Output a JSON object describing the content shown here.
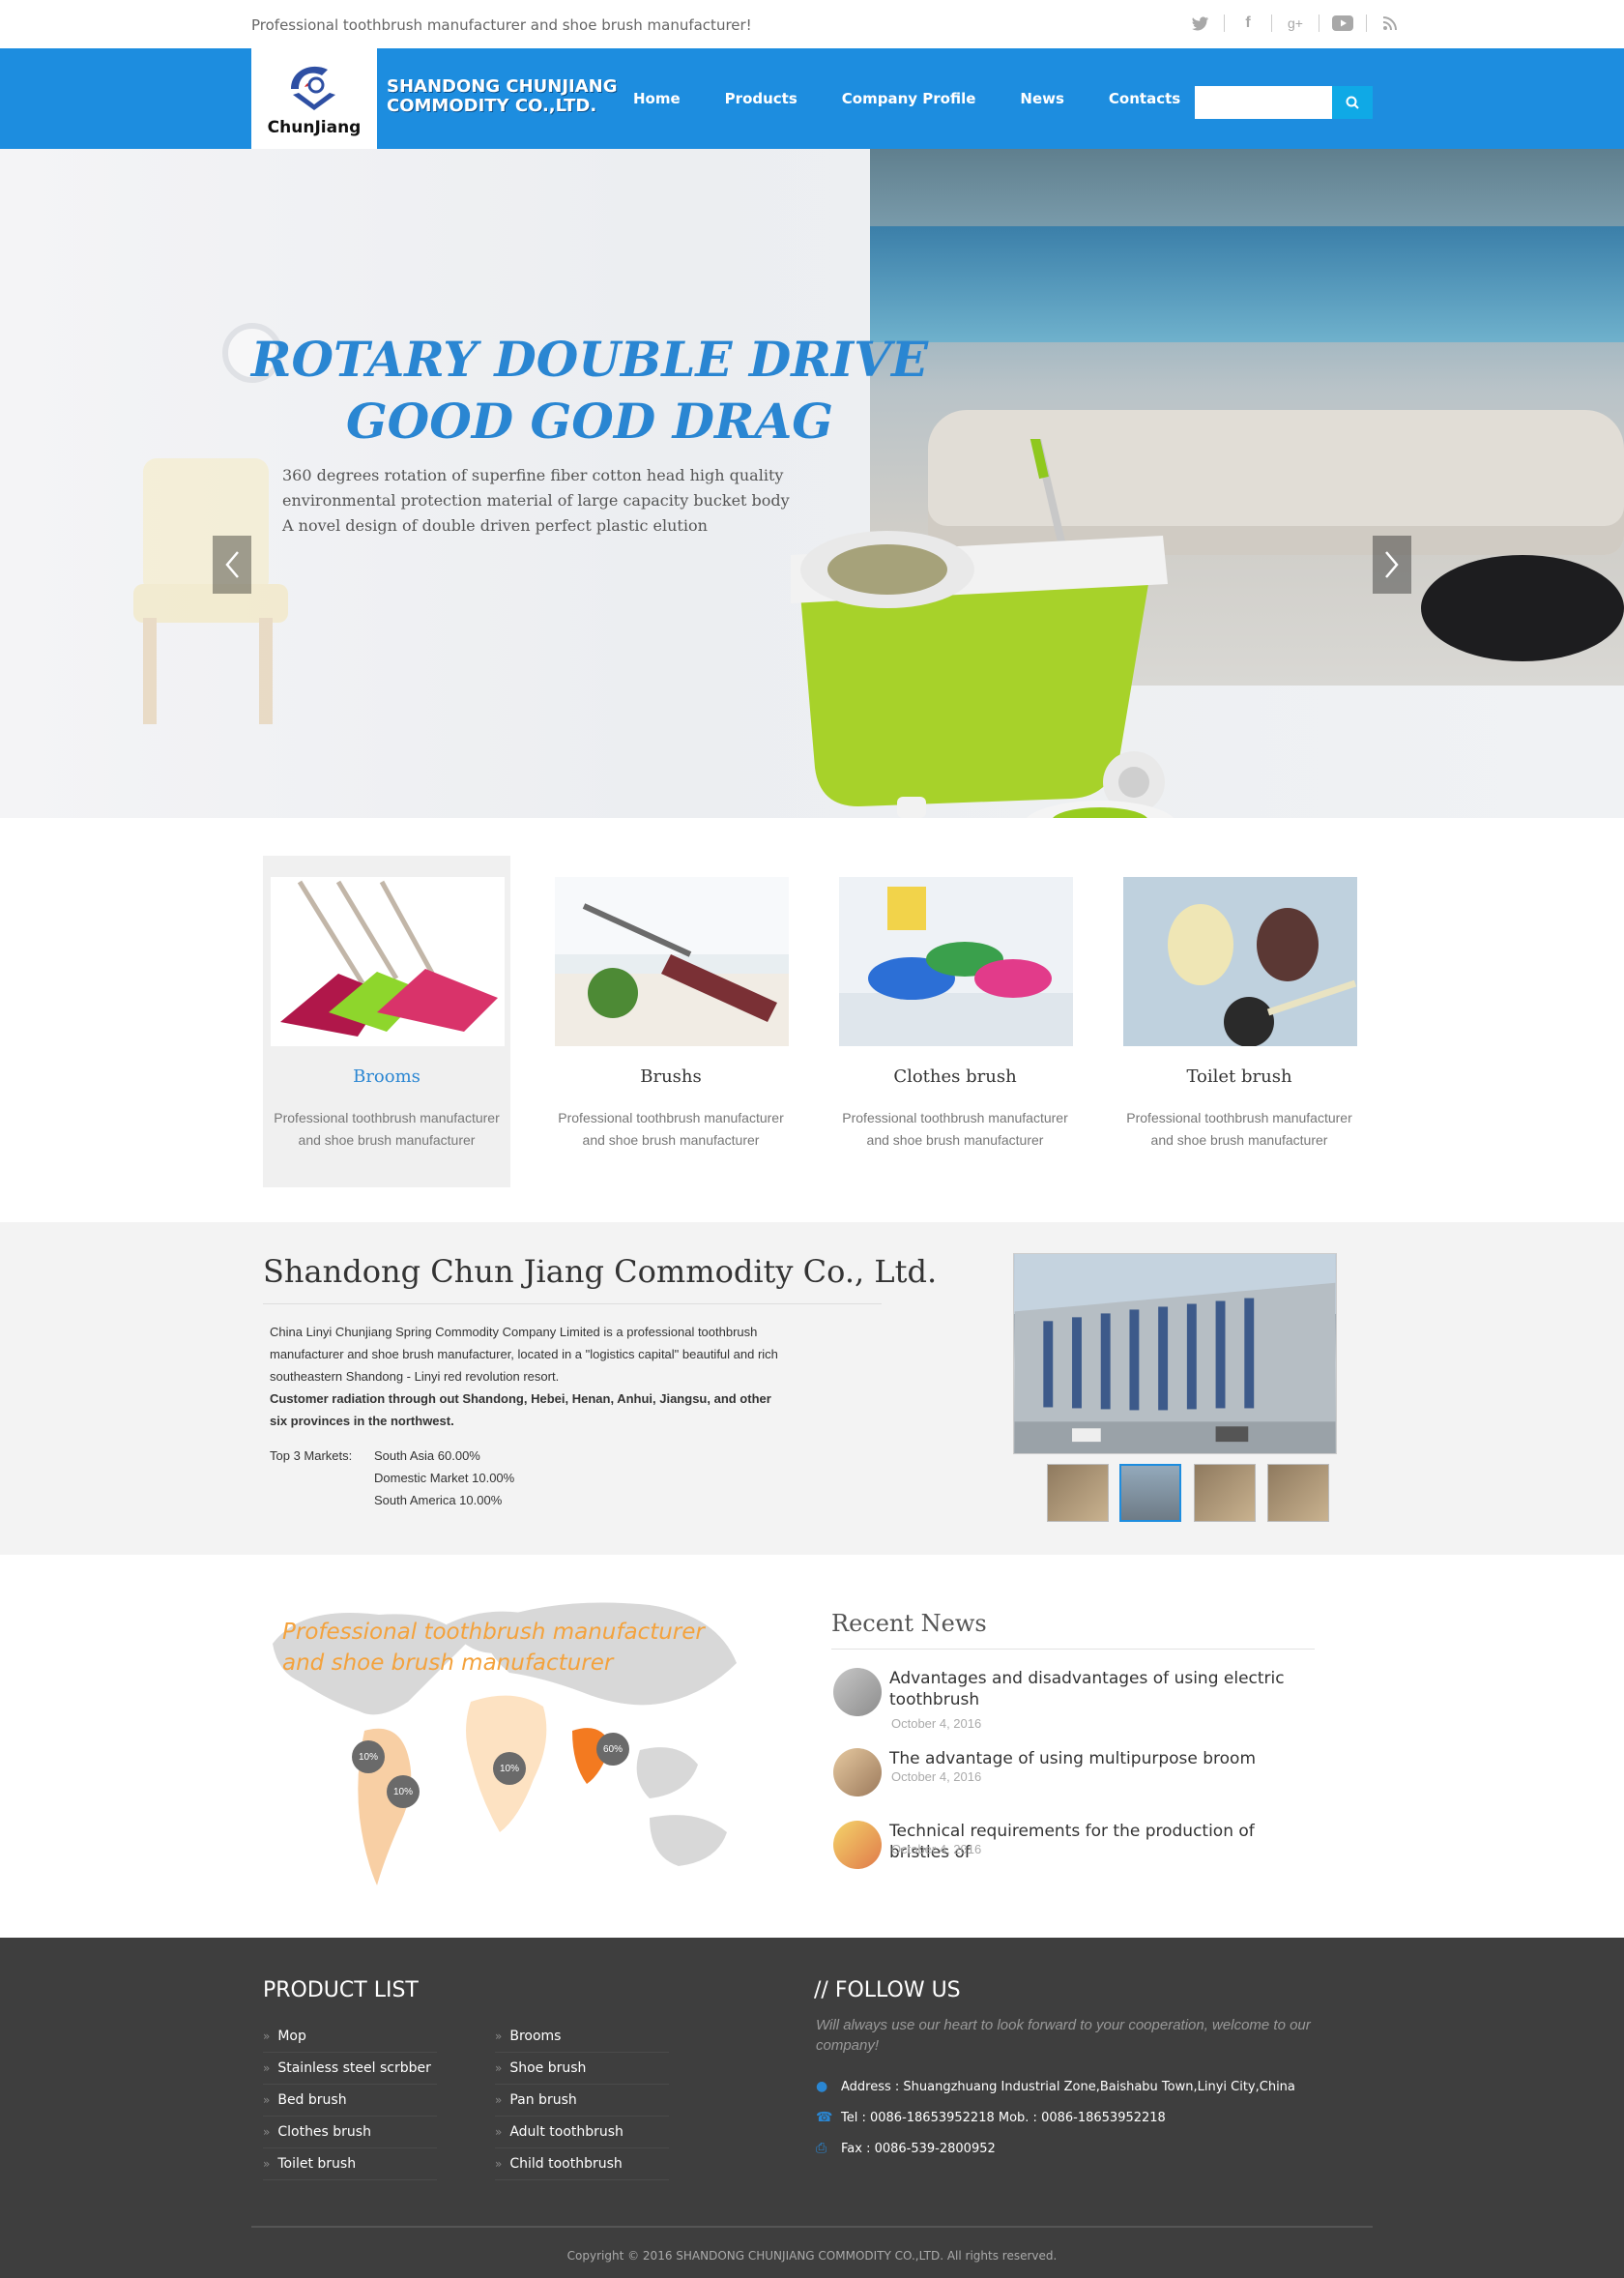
{
  "topbar": {
    "tagline": "Professional toothbrush manufacturer and shoe brush manufacturer!",
    "social_icons": [
      "twitter-icon",
      "facebook-icon",
      "google-plus-icon",
      "youtube-icon",
      "rss-icon"
    ]
  },
  "header": {
    "logo_text": "ChunJiang",
    "company_line1": "SHANDONG CHUNJIANG",
    "company_line2": "COMMODITY CO.,LTD.",
    "nav": [
      "Home",
      "Products",
      "Company Profile",
      "News",
      "Contacts"
    ],
    "search_placeholder": ""
  },
  "hero": {
    "title_line1": "ROTARY DOUBLE DRIVE",
    "title_line2": "GOOD GOD DRAG",
    "text_line1": "360 degrees rotation of superfine fiber cotton head high quality",
    "text_line2": "environmental protection material of large capacity bucket body",
    "text_line3": "A novel design of double driven perfect plastic elution",
    "slides": 3,
    "active_slide": 2
  },
  "categories": [
    {
      "title": "Brooms",
      "desc": "Professional toothbrush manufacturer and shoe brush manufacturer"
    },
    {
      "title": "Brushs",
      "desc": "Professional toothbrush manufacturer and shoe brush manufacturer"
    },
    {
      "title": "Clothes brush",
      "desc": "Professional toothbrush manufacturer and shoe brush manufacturer"
    },
    {
      "title": "Toilet brush",
      "desc": "Professional toothbrush manufacturer and shoe brush manufacturer"
    }
  ],
  "about": {
    "title": "Shandong Chun Jiang Commodity Co., Ltd.",
    "para1": "China Linyi Chunjiang Spring Commodity Company Limited is a professional toothbrush manufacturer and shoe brush manufacturer, located in a \"logistics capital\" beautiful and rich southeastern Shandong - Linyi red revolution resort.",
    "para2": "Customer radiation through out Shandong, Hebei, Henan, Anhui, Jiangsu, and other six provinces in the northwest.",
    "markets_label": "Top 3 Markets:",
    "markets": [
      "South Asia 60.00%",
      "Domestic Market 10.00%",
      "South America 10.00%"
    ]
  },
  "map": {
    "caption": "Professional toothbrush manufacturer and shoe brush manufacturer",
    "pins": [
      "10%",
      "10%",
      "10%",
      "60%"
    ]
  },
  "news": {
    "title": "Recent News",
    "items": [
      {
        "title": "Advantages and disadvantages of using electric toothbrush",
        "date": "October 4, 2016"
      },
      {
        "title": "The advantage of using multipurpose broom",
        "date": "October 4, 2016"
      },
      {
        "title": "Technical requirements for the production of bristles of",
        "date": "October 4, 2016"
      }
    ]
  },
  "footer": {
    "product_list_title": "PRODUCT LIST",
    "col1": [
      "Mop",
      "Stainless steel scrbber",
      "Bed brush",
      "Clothes brush",
      "Toilet brush"
    ],
    "col2": [
      "Brooms",
      "Shoe brush",
      "Pan brush",
      "Adult toothbrush",
      "Child toothbrush"
    ],
    "follow_title": "// FOLLOW US",
    "follow_text": "Will always use our heart to look forward to your cooperation, welcome to our company!",
    "address": "Address : Shuangzhuang Industrial Zone,Baishabu Town,Linyi City,China",
    "tel": "Tel : 0086-18653952218  Mob. : 0086-18653952218",
    "fax": "Fax : 0086-539-2800952",
    "copyright": "Copyright © 2016 SHANDONG CHUNJIANG COMMODITY CO.,LTD.  All rights reserved."
  },
  "colors": {
    "brand_blue": "#1d8ddf",
    "accent_orange": "#f4a23c",
    "footer_bg": "#3e3e3e"
  }
}
